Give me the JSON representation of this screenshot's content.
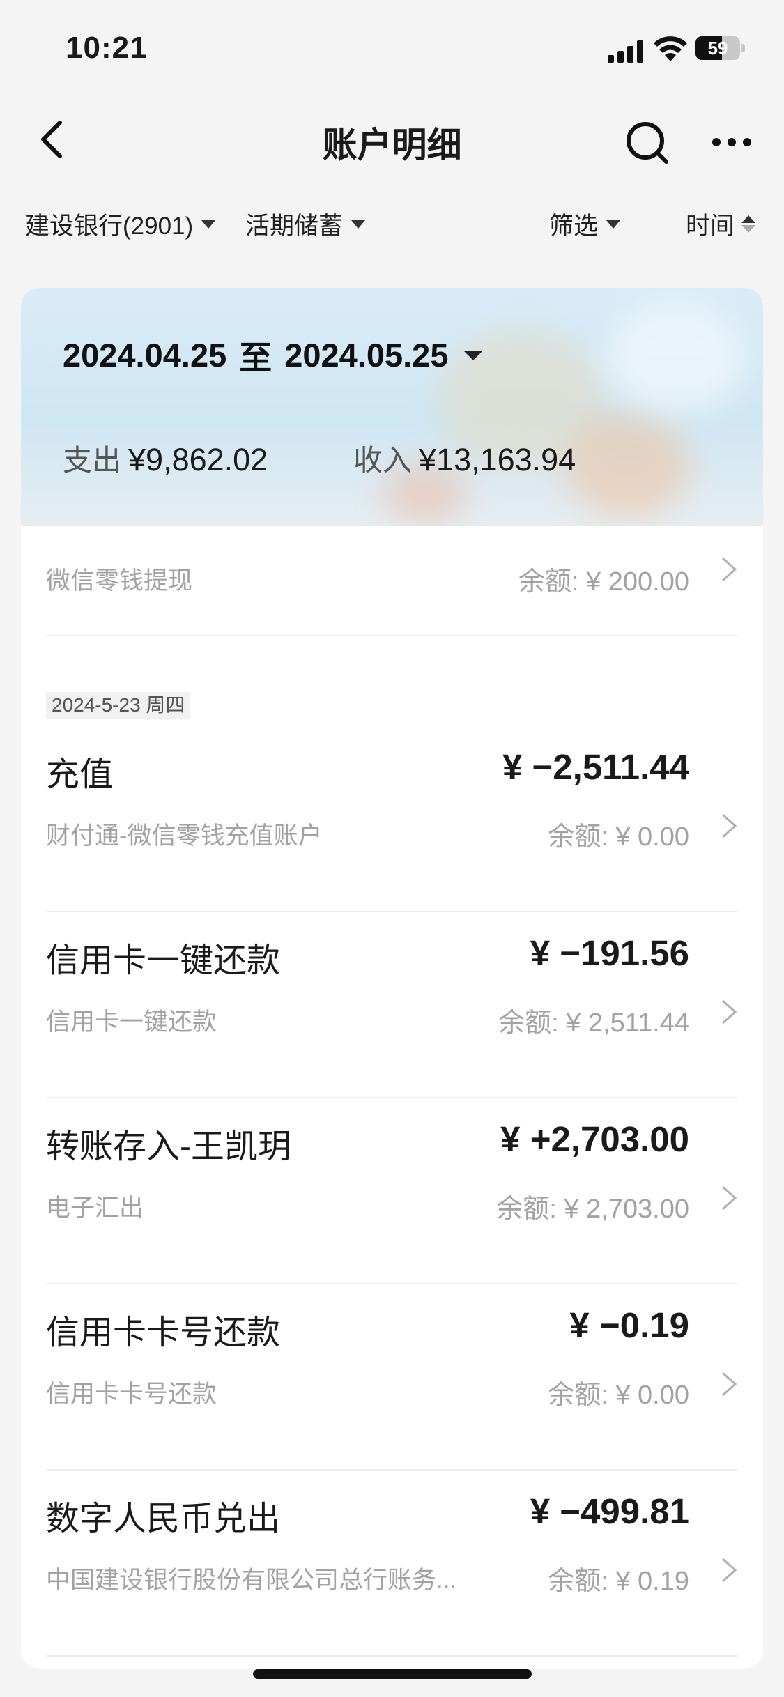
{
  "status_bar": {
    "time": "10:21",
    "battery": "59",
    "battery_level": 0.59
  },
  "nav": {
    "title": "账户明细",
    "back_icon": "chevron-left-icon",
    "search_icon": "search-icon",
    "more_icon": "more-icon"
  },
  "filters": {
    "account": "建设银行(2901)",
    "account_type": "活期储蓄",
    "filter": "筛选",
    "sort": "时间"
  },
  "summary": {
    "start": "2024.04.25",
    "sep": "至",
    "end": "2024.05.25",
    "expense_label": "支出",
    "expense": "¥9,862.02",
    "income_label": "收入",
    "income": "¥13,163.94"
  },
  "partial_row": {
    "subtitle": "微信零钱提现",
    "balance": "余额: ¥ 200.00"
  },
  "date_header": "2024-5-23 周四",
  "transactions": [
    {
      "title": "充值",
      "amount": "¥ −2,511.44",
      "subtitle": "财付通-微信零钱充值账户",
      "balance": "余额: ¥ 0.00"
    },
    {
      "title": "信用卡一键还款",
      "amount": "¥ −191.56",
      "subtitle": "信用卡一键还款",
      "balance": "余额: ¥ 2,511.44"
    },
    {
      "title": "转账存入-王凯玥",
      "amount": "¥ +2,703.00",
      "subtitle": "电子汇出",
      "balance": "余额: ¥ 2,703.00"
    },
    {
      "title": "信用卡卡号还款",
      "amount": "¥ −0.19",
      "subtitle": "信用卡卡号还款",
      "balance": "余额: ¥ 0.00"
    },
    {
      "title": "数字人民币兑出",
      "amount": "¥ −499.81",
      "subtitle": "中国建设银行股份有限公司总行账务...",
      "balance": "余额: ¥ 0.19"
    }
  ],
  "colors": {
    "background": "#f4f4f4",
    "card": "#ffffff",
    "text": "#1a1a1a",
    "muted": "#a2a2a2",
    "banner": "#d9ecf7"
  }
}
